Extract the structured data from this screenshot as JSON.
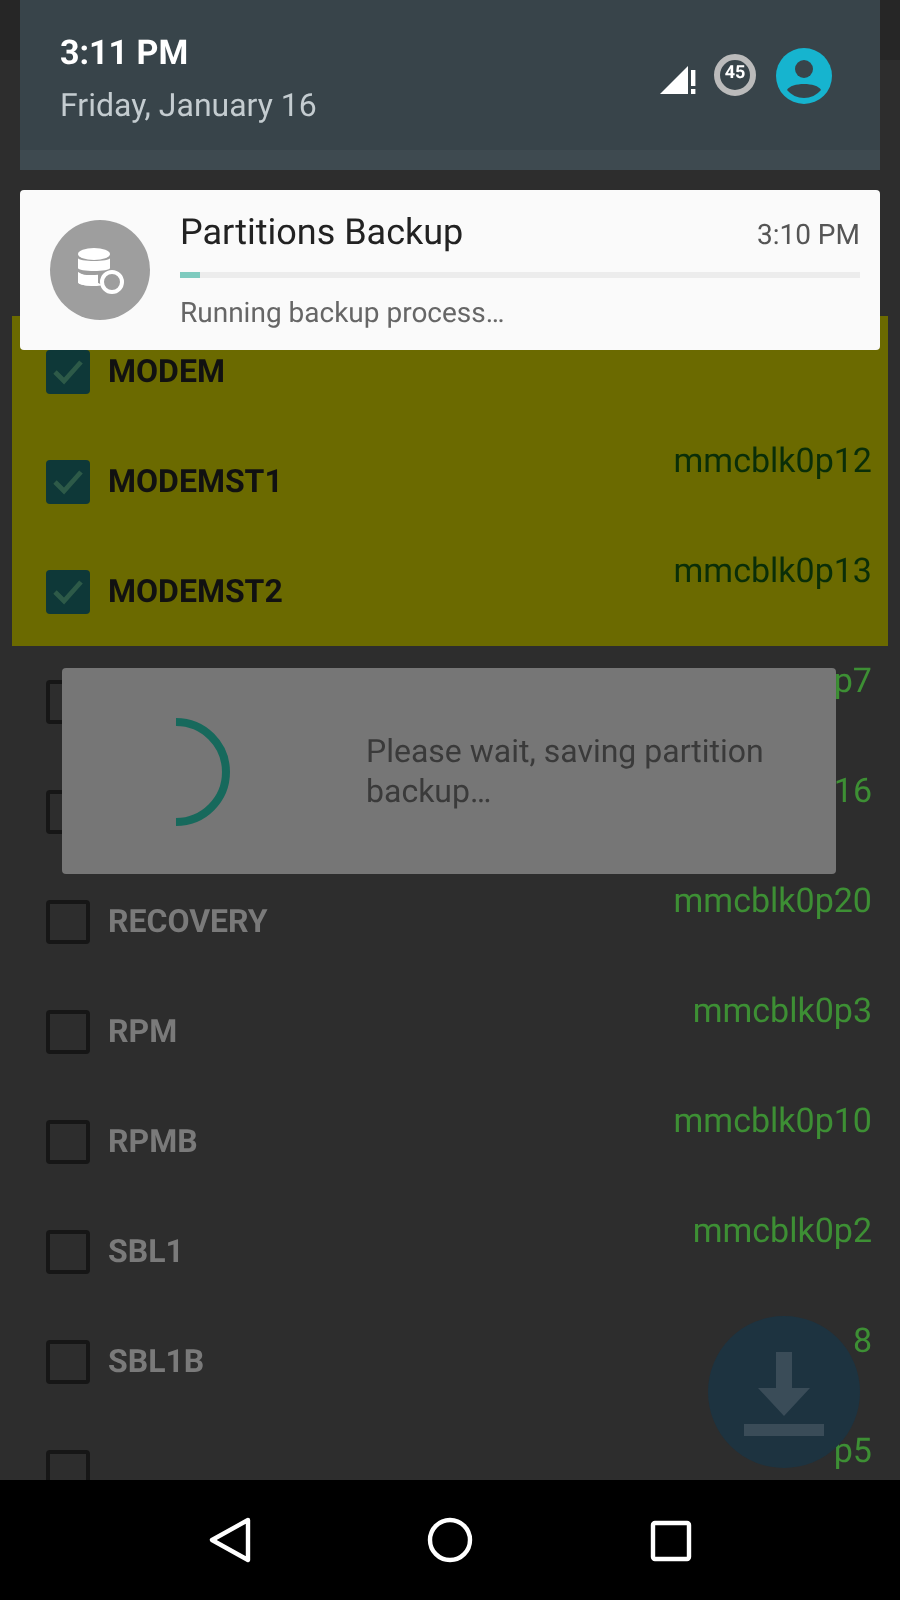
{
  "quick_settings": {
    "time": "3:11 PM",
    "date": "Friday, January 16",
    "data_saver_badge": "45"
  },
  "notification": {
    "title": "Partitions Backup",
    "time": "3:10 PM",
    "level": 0.03,
    "text": "Running backup process…"
  },
  "partitions": [
    {
      "name": "MODEM",
      "checked": true
    },
    {
      "name": "MODEMST1",
      "device": "mmcblk0p12",
      "checked": true
    },
    {
      "name": "MODEMST2",
      "device": "mmcblk0p13",
      "checked": true
    },
    {
      "device": "p7",
      "checked": false
    },
    {
      "device": "16",
      "checked": false
    },
    {
      "name": "RECOVERY",
      "device": "mmcblk0p20",
      "checked": false
    },
    {
      "name": "RPM",
      "device": "mmcblk0p3",
      "checked": false
    },
    {
      "name": "RPMB",
      "device": "mmcblk0p10",
      "checked": false
    },
    {
      "name": "SBL1",
      "device": "mmcblk0p2",
      "checked": false
    },
    {
      "name": "SBL1B",
      "device": "8",
      "checked": false
    },
    {
      "device": "p5",
      "checked": false
    }
  ],
  "dialog": {
    "message": "Please wait, saving partition backup…"
  }
}
